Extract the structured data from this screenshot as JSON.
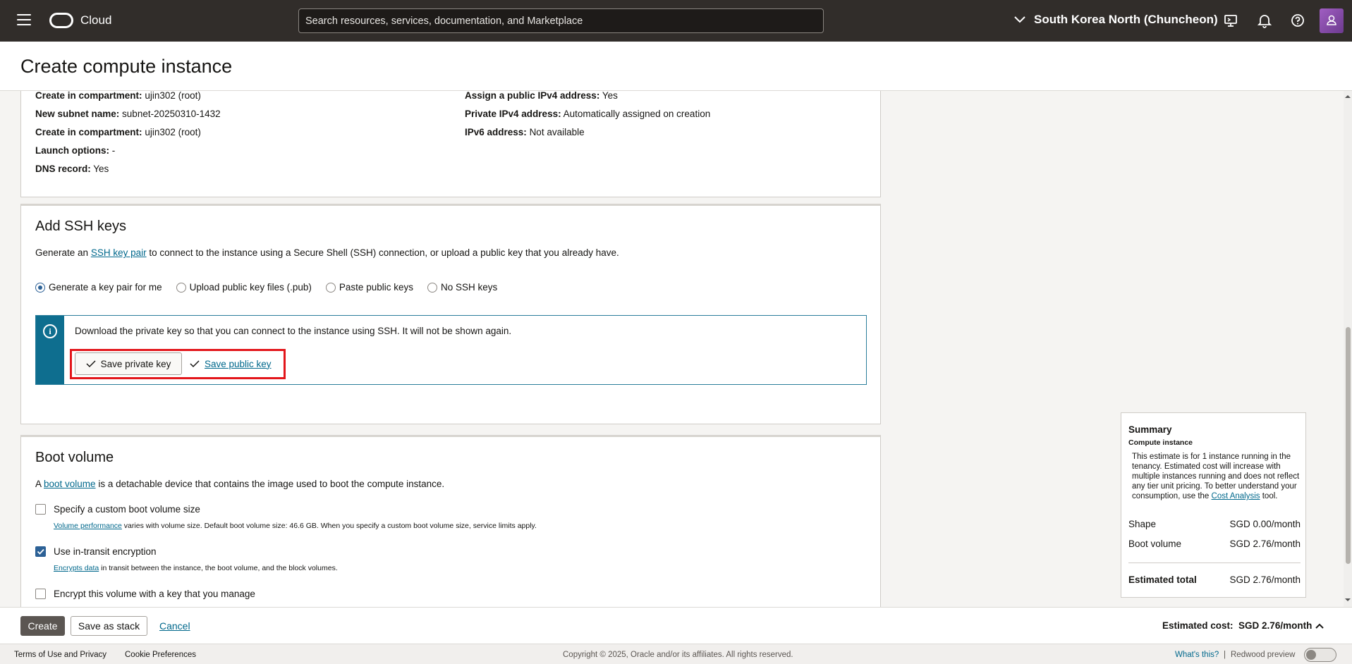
{
  "header": {
    "brand": "Cloud",
    "search_placeholder": "Search resources, services, documentation, and Marketplace",
    "region": "South Korea North (Chuncheon)"
  },
  "page": {
    "title": "Create compute instance"
  },
  "networking_summary": {
    "left": [
      {
        "label": "Create in compartment:",
        "value": "ujin302 (root)"
      },
      {
        "label": "New subnet name:",
        "value": "subnet-20250310-1432"
      },
      {
        "label": "Create in compartment:",
        "value": "ujin302 (root)"
      },
      {
        "label": "Launch options:",
        "value": "-"
      },
      {
        "label": "DNS record:",
        "value": "Yes"
      }
    ],
    "right": [
      {
        "label": "Assign a public IPv4 address:",
        "value": "Yes"
      },
      {
        "label": "Private IPv4 address:",
        "value": "Automatically assigned on creation"
      },
      {
        "label": "IPv6 address:",
        "value": "Not available"
      }
    ]
  },
  "ssh": {
    "title": "Add SSH keys",
    "desc_before": "Generate an ",
    "desc_link": "SSH key pair",
    "desc_after": " to connect to the instance using a Secure Shell (SSH) connection, or upload a public key that you already have.",
    "options": [
      "Generate a key pair for me",
      "Upload public key files (.pub)",
      "Paste public keys",
      "No SSH keys"
    ],
    "selected": "Generate a key pair for me",
    "info_text": "Download the private key so that you can connect to the instance using SSH. It will not be shown again.",
    "save_private_label": "Save private key",
    "save_public_label": "Save public key"
  },
  "boot": {
    "title": "Boot volume",
    "desc_before": "A ",
    "desc_link": "boot volume",
    "desc_after": " is a detachable device that contains the image used to boot the compute instance.",
    "custom_size_label": "Specify a custom boot volume size",
    "perf_link": "Volume performance",
    "perf_note": " varies with volume size. Default boot volume size: 46.6 GB. When you specify a custom boot volume size, service limits apply.",
    "transit_label": "Use in-transit encryption",
    "transit_link": "Encrypts data",
    "transit_note": " in transit between the instance, the boot volume, and the block volumes.",
    "encrypt_label": "Encrypt this volume with a key that you manage"
  },
  "summary": {
    "title": "Summary",
    "subtitle": "Compute instance",
    "desc": "This estimate is for 1 instance running in the tenancy. Estimated cost will increase with multiple instances running and does not reflect any tier unit pricing. To better understand your consumption, use the ",
    "desc_link": "Cost Analysis",
    "desc_end": " tool.",
    "shape_label": "Shape",
    "shape_value": "SGD 0.00/month",
    "boot_label": "Boot volume",
    "boot_value": "SGD 2.76/month",
    "total_label": "Estimated total",
    "total_value": "SGD 2.76/month"
  },
  "actions": {
    "create": "Create",
    "save_stack": "Save as stack",
    "cancel": "Cancel",
    "est_label": "Estimated cost:",
    "est_value": "SGD 2.76/month"
  },
  "footer": {
    "terms": "Terms of Use and Privacy",
    "cookies": "Cookie Preferences",
    "copyright": "Copyright © 2025, Oracle and/or its affiliates. All rights reserved.",
    "whats_this": "What's this?",
    "sep": "|",
    "redwood": "Redwood preview"
  }
}
